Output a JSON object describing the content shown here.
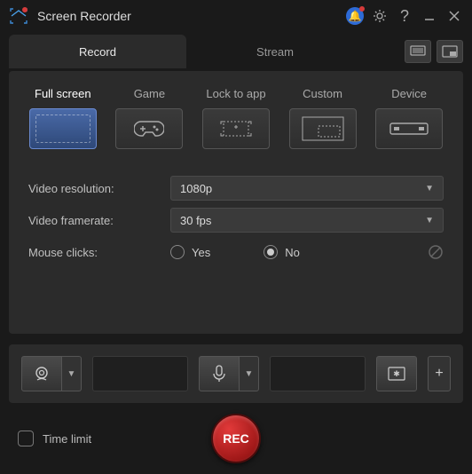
{
  "title": "Screen Recorder",
  "tabs": {
    "record": "Record",
    "stream": "Stream"
  },
  "modes": [
    {
      "label": "Full screen",
      "active": true
    },
    {
      "label": "Game",
      "active": false
    },
    {
      "label": "Lock to app",
      "active": false
    },
    {
      "label": "Custom",
      "active": false
    },
    {
      "label": "Device",
      "active": false
    }
  ],
  "settings": {
    "resolution_label": "Video resolution:",
    "resolution_value": "1080p",
    "framerate_label": "Video framerate:",
    "framerate_value": "30 fps",
    "mouse_label": "Mouse clicks:",
    "mouse_yes": "Yes",
    "mouse_no": "No",
    "mouse_selected": "no"
  },
  "footer": {
    "time_limit_label": "Time limit",
    "time_limit_checked": false,
    "rec_label": "REC"
  }
}
